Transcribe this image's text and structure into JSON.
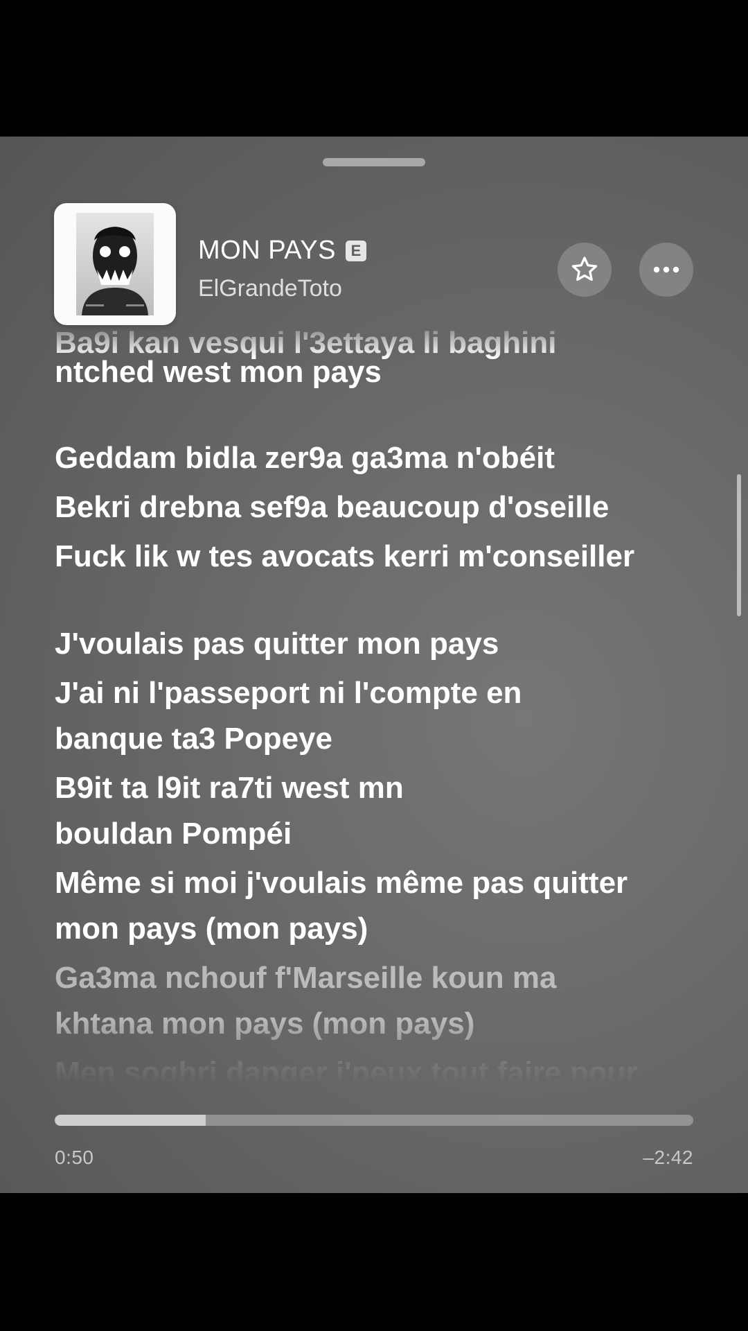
{
  "header": {
    "song_title": "MON PAYS",
    "explicit_badge": "E",
    "artist": "ElGrandeToto",
    "favorite_icon": "star-icon",
    "more_icon": "more-dots-icon"
  },
  "lyrics": {
    "lines": [
      {
        "text": "Ba9i kan vesqui l'3ettaya li baghini",
        "style": "partial"
      },
      {
        "text": "ntched west mon pays",
        "style": "normal"
      },
      {
        "text": "Geddam bidla zer9a ga3ma n'obéit",
        "style": "normal"
      },
      {
        "text": "Bekri drebna sef9a beaucoup d'oseille",
        "style": "normal"
      },
      {
        "text": "Fuck lik w tes avocats kerri m'conseiller",
        "style": "normal"
      },
      {
        "text": "J'voulais pas quitter mon pays",
        "style": "normal"
      },
      {
        "text": "J'ai ni l'passeport ni l'compte en",
        "style": "normal"
      },
      {
        "text": "banque ta3 Popeye",
        "style": "normal"
      },
      {
        "text": "B9it ta l9it ra7ti west mn",
        "style": "normal"
      },
      {
        "text": "bouldan Pompéi",
        "style": "normal"
      },
      {
        "text": "Même si moi j'voulais même pas quitter",
        "style": "normal"
      },
      {
        "text": "mon pays (mon pays)",
        "style": "normal"
      },
      {
        "text": "Ga3ma nchouf f'Marseille koun ma",
        "style": "dim"
      },
      {
        "text": "khtana mon pays (mon pays)",
        "style": "dim"
      },
      {
        "text": "Men soghri danger j'peux tout faire pour",
        "style": "dimmer"
      }
    ]
  },
  "playback": {
    "elapsed": "0:50",
    "remaining": "–2:42",
    "progress": 0.236
  }
}
